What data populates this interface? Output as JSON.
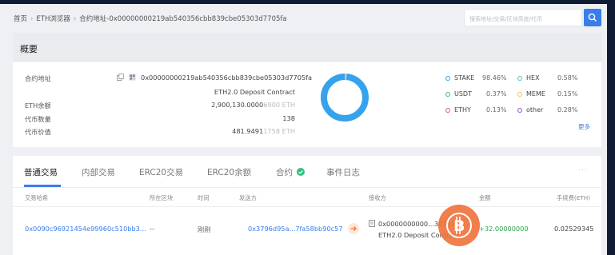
{
  "breadcrumb": {
    "home": "首页",
    "explorer": "ETH浏览器",
    "current": "合约地址-0x00000000219ab540356cbb839cbe05303d7705fa"
  },
  "search": {
    "placeholder": "搜索地址/交易/区块高度/代币"
  },
  "overview": {
    "title": "概要",
    "contract_label": "合约地址",
    "contract_address": "0x00000000219ab540356cbb839cbe05303d7705fa",
    "contract_name": "ETH2.0 Deposit Contract",
    "eth_balance_label": "ETH余额",
    "eth_balance_main": "2,900,130.0000",
    "eth_balance_dim": "6900 ETH",
    "token_count_label": "代币数量",
    "token_count": "138",
    "token_value_label": "代币价值",
    "token_value_main": "481.9491",
    "token_value_dim": "1758 ETH",
    "legend": [
      {
        "name": "STAKE",
        "pct": "98.46%",
        "color": "#36a2ec"
      },
      {
        "name": "USDT",
        "pct": "0.37%",
        "color": "#2ec27e"
      },
      {
        "name": "ETHY",
        "pct": "0.13%",
        "color": "#e05a6d"
      },
      {
        "name": "HEX",
        "pct": "0.58%",
        "color": "#3fc9c6"
      },
      {
        "name": "MEME",
        "pct": "0.15%",
        "color": "#f3c53d"
      },
      {
        "name": "other",
        "pct": "0.28%",
        "color": "#7a5bd6"
      }
    ],
    "more": "更多",
    "donut_colors": {
      "main": "#36a2ec",
      "other": "#c0c4cc"
    }
  },
  "tabs": [
    "普通交易",
    "内部交易",
    "ERC20交易",
    "ERC20余额",
    "合约",
    "事件日志"
  ],
  "table": {
    "headers": [
      "交易哈希",
      "所在区块",
      "时间",
      "发送方",
      "接收方",
      "金额",
      "手续费(ETH)"
    ],
    "row": {
      "hash": "0x0090c96921454e99960c510bb3...",
      "block": "--",
      "time": "刚刚",
      "from": "0x3796d95a...7fa58bb90c57",
      "to_addr": "0x0000000000...303d77",
      "to_name": "ETH2.0 Deposit Contract",
      "amount": "+32.00000000",
      "fee": "0.02529345"
    }
  }
}
